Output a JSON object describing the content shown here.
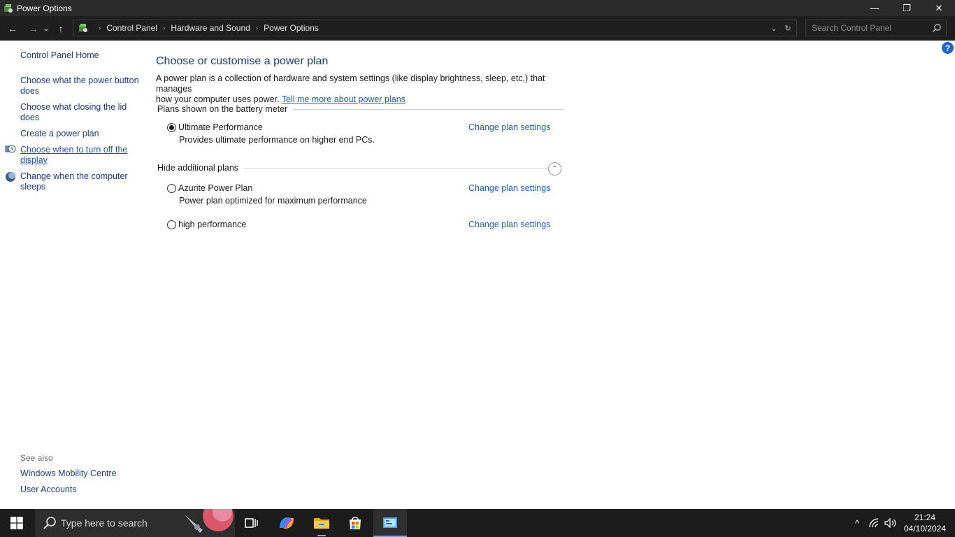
{
  "window": {
    "title": "Power Options",
    "minimize_glyph": "—",
    "restore_glyph": "❐",
    "close_glyph": "✕"
  },
  "nav": {
    "back": "←",
    "forward": "→",
    "recent": "⌄",
    "up": "↑",
    "breadcrumbs": [
      "Control Panel",
      "Hardware and Sound",
      "Power Options"
    ],
    "separator": "›",
    "dropdown": "⌄",
    "refresh": "↻",
    "search_placeholder": "Search Control Panel"
  },
  "help": {
    "label": "?"
  },
  "sidebar": {
    "home": "Control Panel Home",
    "items": [
      {
        "label": "Choose what the power button does"
      },
      {
        "label": "Choose what closing the lid does"
      },
      {
        "label": "Create a power plan"
      },
      {
        "label": "Choose when to turn off the display",
        "icon": "clock-icon"
      },
      {
        "label": "Change when the computer sleeps",
        "icon": "moon-icon"
      }
    ],
    "see_also_title": "See also",
    "see_also": [
      "Windows Mobility Centre",
      "User Accounts"
    ]
  },
  "main": {
    "heading": "Choose or customise a power plan",
    "description_line1": "A power plan is a collection of hardware and system settings (like display brightness, sleep, etc.) that manages",
    "description_line2": "how your computer uses power.",
    "learn_more": "Tell me more about power plans",
    "section_battery": "Plans shown on the battery meter",
    "section_additional": "Hide additional plans",
    "collapse_glyph": "⌃",
    "change_label": "Change plan settings",
    "plans": [
      {
        "name": "Ultimate Performance",
        "description": "Provides ultimate performance on higher end PCs.",
        "selected": true
      },
      {
        "name": "Azurite Power Plan",
        "description": "Power plan optimized for maximum performance",
        "selected": false
      },
      {
        "name": "high performance",
        "description": "",
        "selected": false
      }
    ]
  },
  "taskbar": {
    "search_placeholder": "Type here to search",
    "tray_chevron": "^",
    "time": "21:24",
    "date": "04/10/2024"
  },
  "colors": {
    "link": "#1f5bc6",
    "heading": "#1e3a8a",
    "titlebar": "#2b2b2b",
    "taskbar": "#1c1c1c"
  }
}
